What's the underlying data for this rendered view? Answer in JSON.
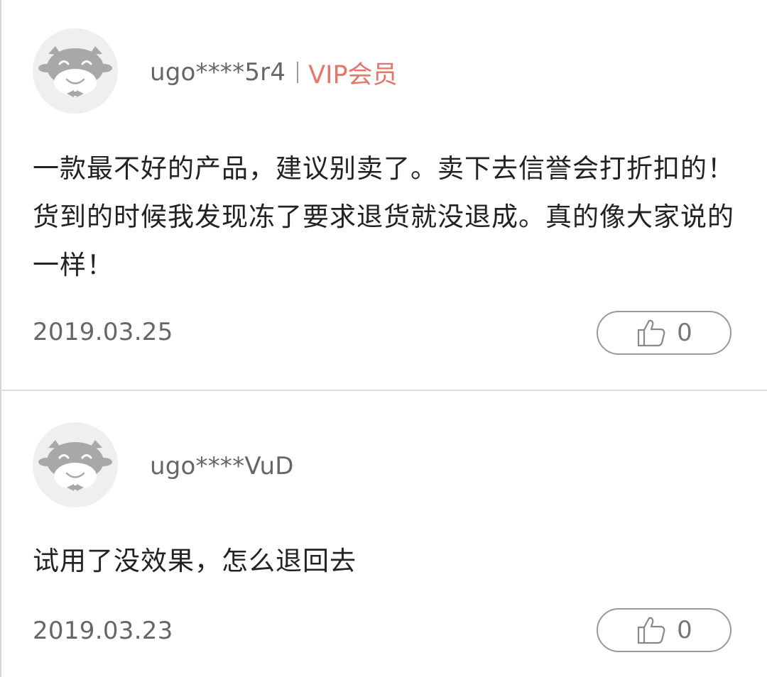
{
  "comments": [
    {
      "avatar_icon": "cow-avatar-icon",
      "username": "ugo****5r4",
      "badge": "VIP会员",
      "text": "一款最不好的产品，建议别卖了。卖下去信誉会打折扣的！货到的时候我发现冻了要求退货就没退成。真的像大家说的一样！",
      "date": "2019.03.25",
      "likes": "0",
      "like_icon": "thumbs-up-icon"
    },
    {
      "avatar_icon": "cow-avatar-icon",
      "username": "ugo****VuD",
      "text": "试用了没效果，怎么退回去",
      "date": "2019.03.23",
      "likes": "0",
      "like_icon": "thumbs-up-icon"
    }
  ],
  "colors": {
    "vip": "#e5766a",
    "meta_text": "#666666",
    "body_text": "#222222",
    "avatar_bg": "#efefef",
    "divider": "#dcdcdc"
  }
}
